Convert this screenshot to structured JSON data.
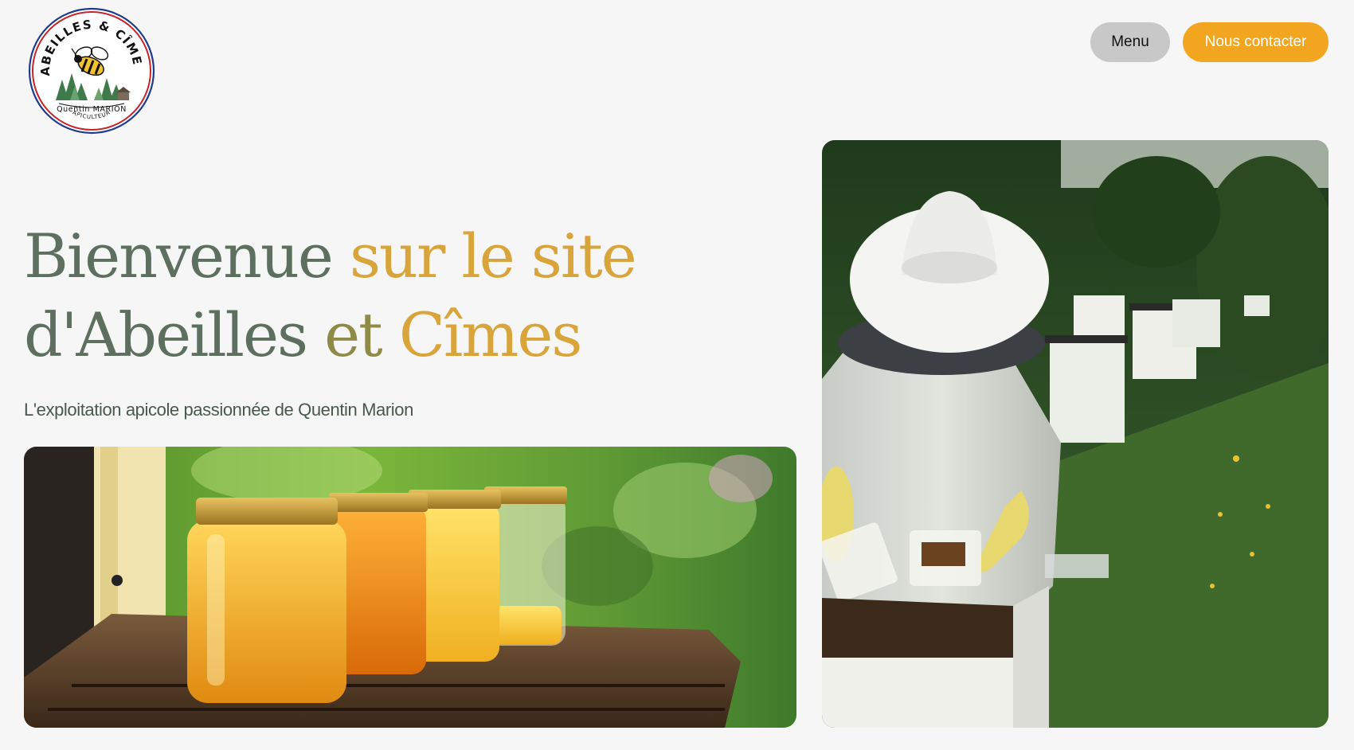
{
  "header": {
    "logo": {
      "arc_text": "ABEILLES & CÎMES",
      "name_text": "Quentin MARION",
      "role_text": "APICULTEUR",
      "icon": "bee-logo-icon"
    },
    "menu_label": "Menu",
    "contact_label": "Nous contacter"
  },
  "hero": {
    "title_line1_a": "Bienvenue ",
    "title_line1_b": "sur le site",
    "title_line2_a": "d'Abeilles ",
    "title_line2_b": "et ",
    "title_line2_c": "Cîmes",
    "subtitle": "L'exploitation apicole passionnée de Quentin Marion"
  },
  "photos": {
    "left": "honey-jars-photo",
    "right": "beekeeper-photo"
  },
  "colors": {
    "background": "#f6f6f6",
    "accent": "#f2a61f",
    "menu_button": "#c8c8c8",
    "title_green": "#5d705f",
    "title_gold": "#d9a43a",
    "subtitle": "#47594c"
  }
}
